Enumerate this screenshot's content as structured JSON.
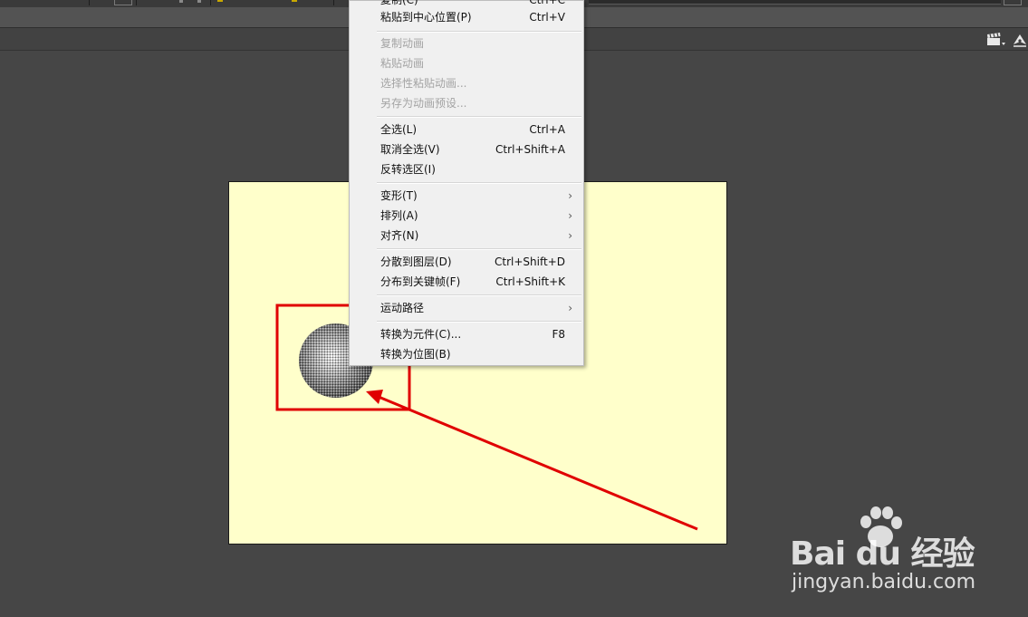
{
  "menu": {
    "items": [
      {
        "label": "复制(C)",
        "shortcut": "Ctrl+C",
        "disabled": false
      },
      {
        "label": "粘贴到中心位置(P)",
        "shortcut": "Ctrl+V",
        "disabled": false
      },
      {
        "label": "复制动画",
        "shortcut": "",
        "disabled": true
      },
      {
        "label": "粘贴动画",
        "shortcut": "",
        "disabled": true
      },
      {
        "label": "选择性粘贴动画...",
        "shortcut": "",
        "disabled": true
      },
      {
        "label": "另存为动画预设...",
        "shortcut": "",
        "disabled": true
      },
      {
        "label": "全选(L)",
        "shortcut": "Ctrl+A",
        "disabled": false
      },
      {
        "label": "取消全选(V)",
        "shortcut": "Ctrl+Shift+A",
        "disabled": false
      },
      {
        "label": "反转选区(I)",
        "shortcut": "",
        "disabled": false
      },
      {
        "label": "变形(T)",
        "shortcut": "",
        "submenu": true
      },
      {
        "label": "排列(A)",
        "shortcut": "",
        "submenu": true
      },
      {
        "label": "对齐(N)",
        "shortcut": "",
        "submenu": true
      },
      {
        "label": "分散到图层(D)",
        "shortcut": "Ctrl+Shift+D",
        "disabled": false
      },
      {
        "label": "分布到关键帧(F)",
        "shortcut": "Ctrl+Shift+K",
        "disabled": false
      },
      {
        "label": "运动路径",
        "shortcut": "",
        "submenu": true
      },
      {
        "label": "转换为元件(C)...",
        "shortcut": "F8",
        "disabled": false
      },
      {
        "label": "转换为位图(B)",
        "shortcut": "",
        "disabled": false
      }
    ],
    "submenu_arrow": "›"
  },
  "stage": {
    "background_color": "#ffffcb"
  },
  "annotation": {
    "color": "#e00000"
  },
  "toolbar": {
    "icons": [
      "clapperboard-icon",
      "pen-icon"
    ]
  },
  "watermark": {
    "brand": "Bai du 经验",
    "url": "jingyan.baidu.com"
  }
}
